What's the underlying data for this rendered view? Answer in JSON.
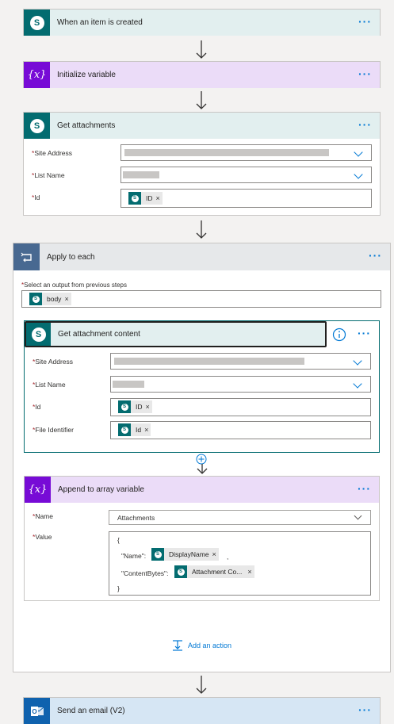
{
  "steps": {
    "trigger": {
      "title": "When an item is created",
      "more": "···"
    },
    "init": {
      "title": "Initialize variable",
      "more": "···"
    },
    "get_attachments": {
      "title": "Get attachments",
      "more": "···",
      "fields": {
        "site_label": "Site Address",
        "list_label": "List Name",
        "id_label": "Id",
        "id_token": "ID"
      }
    },
    "apply": {
      "title": "Apply to each",
      "more": "···",
      "select_label": "Select an output from previous steps",
      "body_token": "body",
      "get_content": {
        "title": "Get attachment content",
        "more": "···",
        "fields": {
          "site_label": "Site Address",
          "list_label": "List Name",
          "id_label": "Id",
          "id_token": "ID",
          "file_label": "File Identifier",
          "file_token": "Id"
        }
      },
      "append": {
        "title": "Append to array variable",
        "more": "···",
        "name_label": "Name",
        "name_value": "Attachments",
        "value_label": "Value",
        "json_open": "{",
        "name_key": "\"Name\":",
        "name_token": "DisplayName",
        "name_sep": ",",
        "bytes_key": "\"ContentBytes\":",
        "bytes_token": "Attachment Co...",
        "json_close": "}"
      },
      "add_action": "Add an action"
    },
    "send_email": {
      "title": "Send an email (V2)",
      "more": "···"
    }
  },
  "required_mark": "*",
  "token_remove": "×",
  "sp_letter": "S",
  "var_symbol": "{x}",
  "colors": {
    "sharepoint": "#036c70",
    "variable": "#770bd6",
    "loop": "#486991",
    "outlook": "#0f62ae",
    "accent": "#0078d4"
  }
}
